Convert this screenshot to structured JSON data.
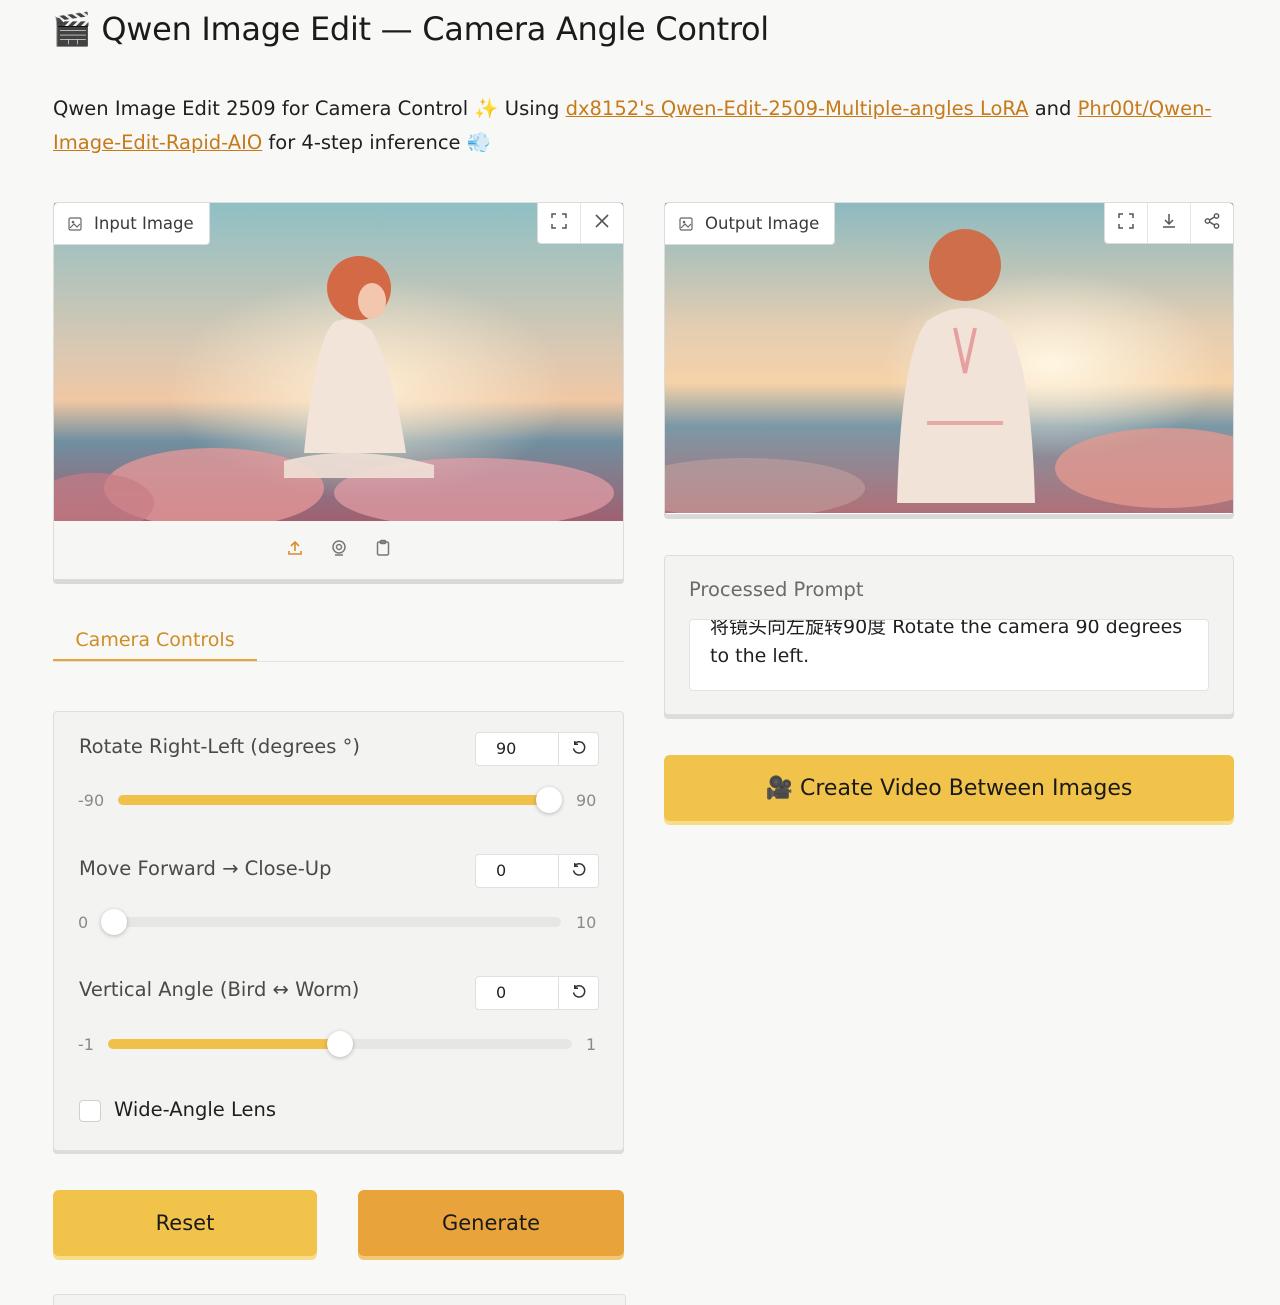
{
  "header": {
    "title": "🎬 Qwen Image Edit — Camera Angle Control"
  },
  "description": {
    "text1": "Qwen Image Edit 2509 for Camera Control ✨ Using ",
    "link1": "dx8152's Qwen-Edit-2509-Multiple-angles LoRA",
    "text2": " and ",
    "link2": "Phr00t/Qwen-Image-Edit-Rapid-AIO",
    "text3": " for 4-step inference 💨"
  },
  "input_image": {
    "label": "Input Image",
    "icons": [
      "fullscreen-icon",
      "close-icon",
      "upload-icon",
      "webcam-icon",
      "clipboard-icon"
    ]
  },
  "output_image": {
    "label": "Output Image",
    "icons": [
      "fullscreen-icon",
      "download-icon",
      "share-icon"
    ]
  },
  "tabs": {
    "camera_controls": "Camera Controls"
  },
  "sliders": {
    "rotate": {
      "label": "Rotate Right-Left (degrees °)",
      "value": "90",
      "min": "-90",
      "max": "90",
      "fill_fraction": 1.0
    },
    "forward": {
      "label": "Move Forward → Close-Up",
      "value": "0",
      "min": "0",
      "max": "10",
      "fill_fraction": 0.0
    },
    "vertical": {
      "label": "Vertical Angle (Bird ↔ Worm)",
      "value": "0",
      "min": "-1",
      "max": "1",
      "fill_fraction": 0.5
    }
  },
  "wide_angle": {
    "label": "Wide-Angle Lens",
    "checked": false
  },
  "buttons": {
    "reset": "Reset",
    "generate": "Generate",
    "create_video": "🎥 Create Video Between Images"
  },
  "prompt": {
    "title": "Processed Prompt",
    "text": "将镜头向左旋转90度 Rotate the camera 90 degrees to the left."
  },
  "colors": {
    "accent": "#f2c34a",
    "accent_dark": "#e8a33b",
    "link": "#c67a1a",
    "tab_active": "#d08c25"
  }
}
